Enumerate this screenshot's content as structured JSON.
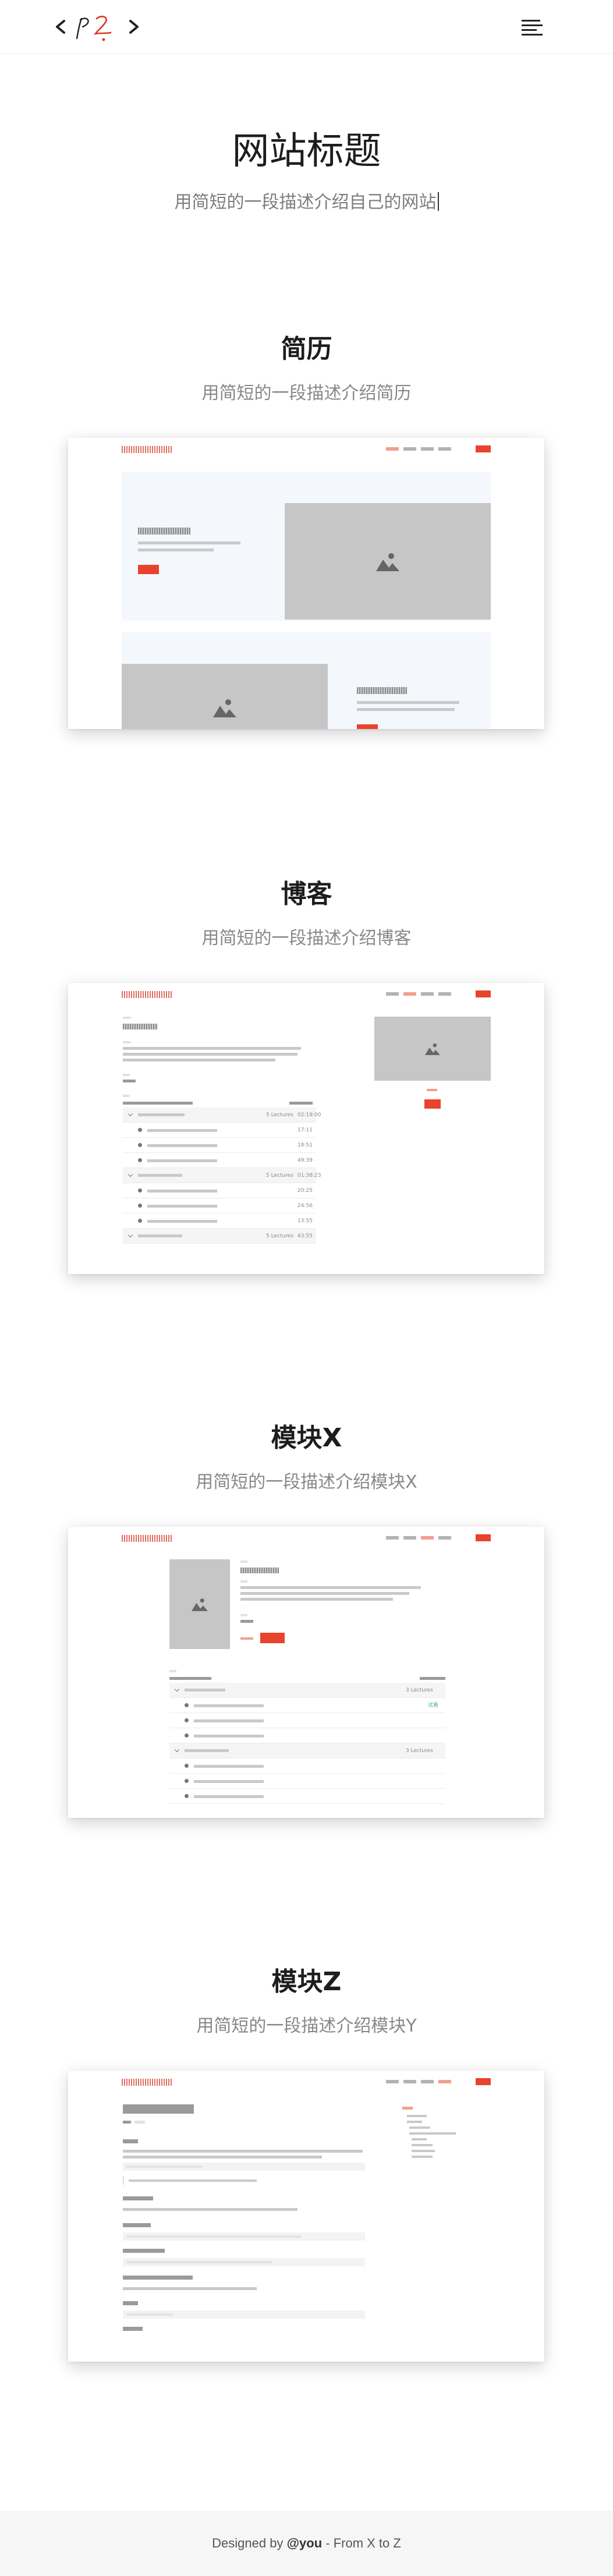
{
  "header": {
    "logo_alt": "p2 logo",
    "menu_icon": "hamburger-menu-icon"
  },
  "hero": {
    "title": "网站标题",
    "subtitle": "用简短的一段描述介绍自己的网站"
  },
  "sections": [
    {
      "title": "简历",
      "subtitle": "用简短的一段描述介绍简历"
    },
    {
      "title": "博客",
      "subtitle": "用简短的一段描述介绍博客"
    },
    {
      "title": "模块X",
      "subtitle": "用简短的一段描述介绍模块X"
    },
    {
      "title": "模块Z",
      "subtitle": "用简短的一段描述介绍模块Y"
    }
  ],
  "footer": {
    "prefix": "Designed by ",
    "author": "@you",
    "suffix": " - From X to Z"
  },
  "colors": {
    "accent": "#e8432c",
    "logo_red": "#d9361f",
    "footer_bg": "#f6f6f6"
  }
}
